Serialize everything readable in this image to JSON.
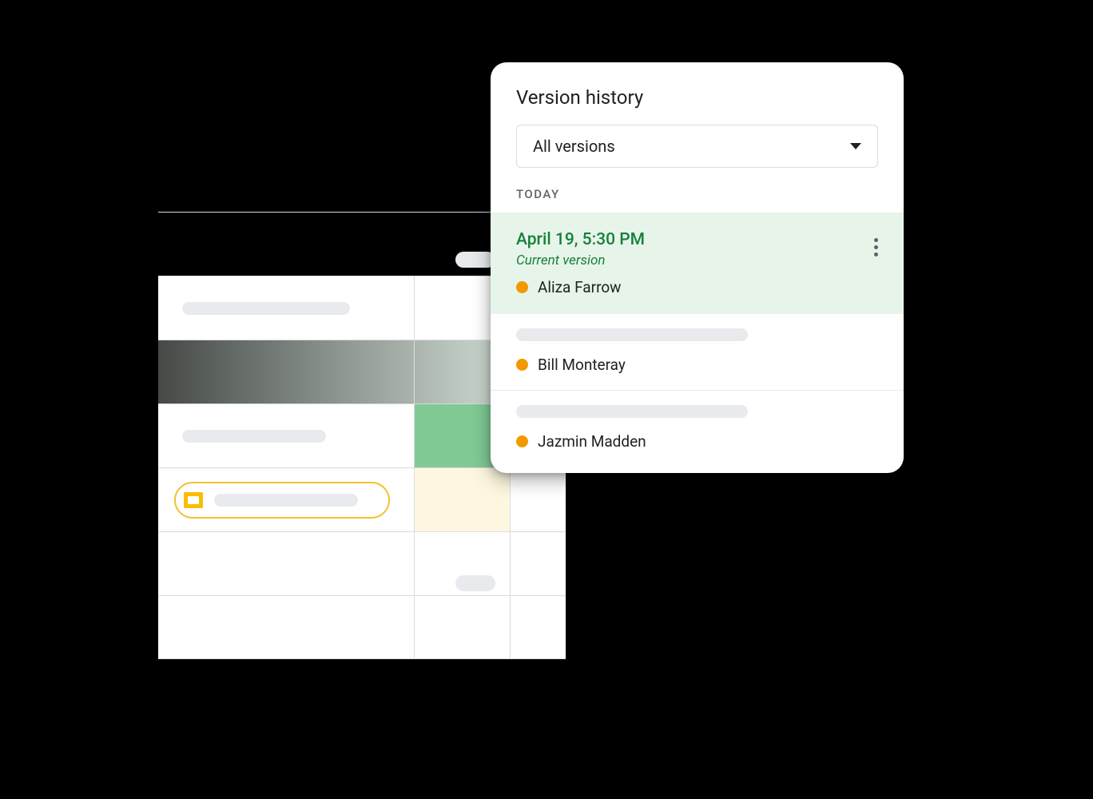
{
  "panel": {
    "title": "Version history",
    "dropdown_label": "All versions",
    "section_label": "TODAY"
  },
  "versions": [
    {
      "timestamp": "April 19, 5:30 PM",
      "subtitle": "Current version",
      "author": "Aliza Farrow",
      "dot_color": "#f29900",
      "current": true
    },
    {
      "author": "Bill Monteray",
      "dot_color": "#f29900",
      "current": false
    },
    {
      "author": "Jazmin Madden",
      "dot_color": "#f29900",
      "current": false
    }
  ]
}
